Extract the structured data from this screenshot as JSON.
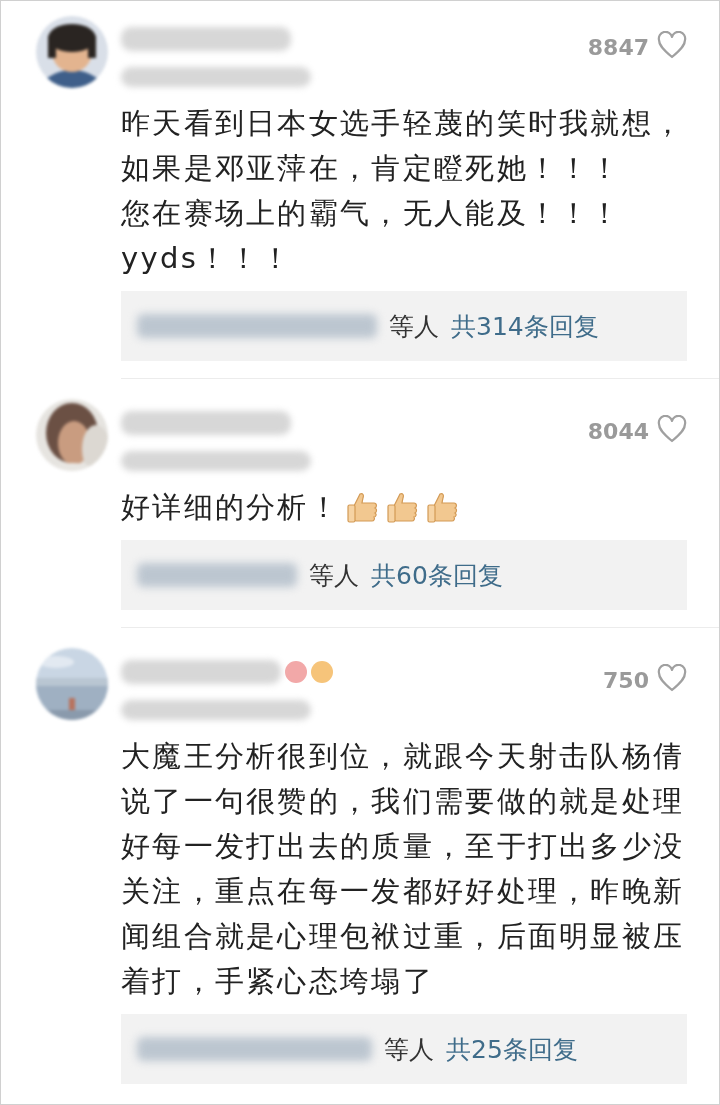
{
  "comments": [
    {
      "avatar": {
        "kind": "picture"
      },
      "likes": "8847",
      "liked": false,
      "text_lines": [
        "昨天看到日本女选手轻蔑的笑时我就想，",
        "如果是邓亚萍在，肯定瞪死她！！！",
        "您在赛场上的霸气，无人能及！！！",
        "yyds！！！"
      ],
      "replies": {
        "suffix": "等人",
        "count_link": "共314条回复"
      }
    },
    {
      "avatar": {
        "kind": "picture"
      },
      "likes": "8044",
      "liked": false,
      "text_lines": [
        "好详细的分析！"
      ],
      "reactions": [
        {
          "kind": "thumbs-up"
        },
        {
          "kind": "thumbs-up"
        },
        {
          "kind": "thumbs-up"
        }
      ],
      "replies": {
        "suffix": "等人",
        "count_link": "共60条回复"
      }
    },
    {
      "avatar": {
        "kind": "picture"
      },
      "likes": "750",
      "liked": false,
      "badges": [
        {
          "color": "#f2a8a8"
        },
        {
          "color": "#f6c47a"
        }
      ],
      "text_lines": [
        "大魔王分析很到位，就跟今天射击队杨倩",
        "说了一句很赞的，我们需要做的就是处理",
        "好每一发打出去的质量，至于打出多少没",
        "关注，重点在每一发都好好处理，昨晚新",
        "闻组合就是心理包袱过重，后面明显被压",
        "着打，手紧心态垮塌了"
      ],
      "replies": {
        "suffix": "等人",
        "count_link": "共25条回复"
      }
    }
  ]
}
